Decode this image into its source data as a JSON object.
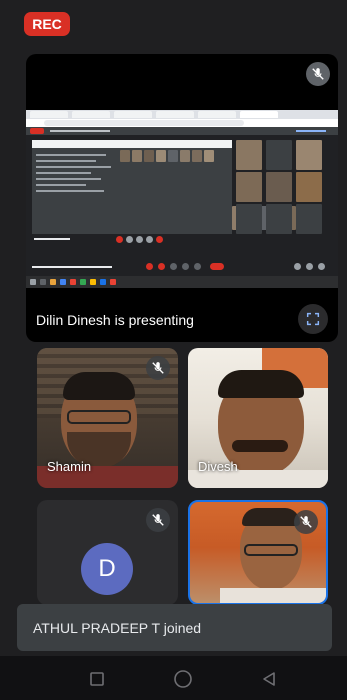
{
  "rec_label": "REC",
  "presentation": {
    "label": "Dilin Dinesh is presenting",
    "mute_icon": "mic-off-icon",
    "fullscreen_icon": "fullscreen-icon"
  },
  "participants": [
    {
      "name": "Shamin",
      "muted": true
    },
    {
      "name": "Divesh",
      "muted": false
    },
    {
      "name": "",
      "initial": "D",
      "muted": true
    },
    {
      "name": "",
      "muted": true,
      "active_speaker": true
    }
  ],
  "toast": "ATHUL PRADEEP T joined",
  "nav": {
    "square_icon": "recents-icon",
    "circle_icon": "home-icon",
    "triangle_icon": "back-icon"
  },
  "colors": {
    "rec": "#d93025",
    "avatar": "#5c6bc0",
    "active_border": "#1a73e8",
    "background": "#1f1f21"
  }
}
